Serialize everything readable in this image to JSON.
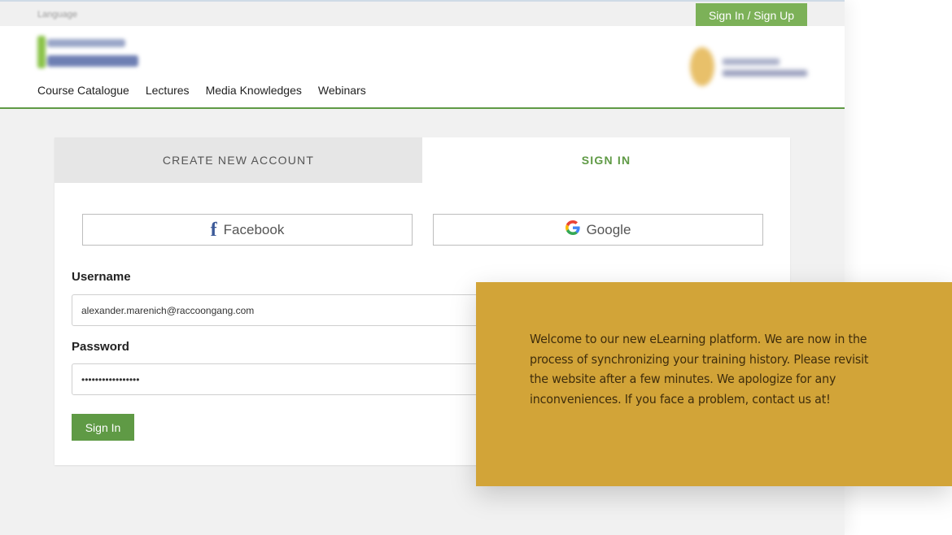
{
  "topbar": {
    "language_label": "Language",
    "auth_button": "Sign In / Sign Up"
  },
  "header": {
    "logo_left_alt": "eLearning logo",
    "logo_right_alt": "Partner emblem logo",
    "nav": [
      {
        "label": "Course Catalogue"
      },
      {
        "label": "Lectures"
      },
      {
        "label": "Media Knowledges"
      },
      {
        "label": "Webinars"
      }
    ]
  },
  "auth_card": {
    "tabs": [
      {
        "label": "CREATE NEW ACCOUNT",
        "active": false
      },
      {
        "label": "SIGN IN",
        "active": true
      }
    ],
    "social": {
      "facebook_label": "Facebook",
      "google_label": "Google"
    },
    "username": {
      "label": "Username",
      "value": "alexander.marenich@raccoongang.com"
    },
    "password": {
      "label": "Password",
      "value": "•••••••••••••••••"
    },
    "submit_label": "Sign In"
  },
  "callout": {
    "message": "Welcome to our new eLearning platform. We are now in the process of synchronizing your training history. Please revisit the website after a few minutes. We apologize for any inconveniences. If you face a problem, contact us at!"
  },
  "colors": {
    "brand_green": "#5f9a45",
    "topbar_button_green": "#7cb158",
    "callout_mustard": "#d2a438",
    "callout_text": "#3f2d0c",
    "facebook_blue": "#3b5998"
  }
}
